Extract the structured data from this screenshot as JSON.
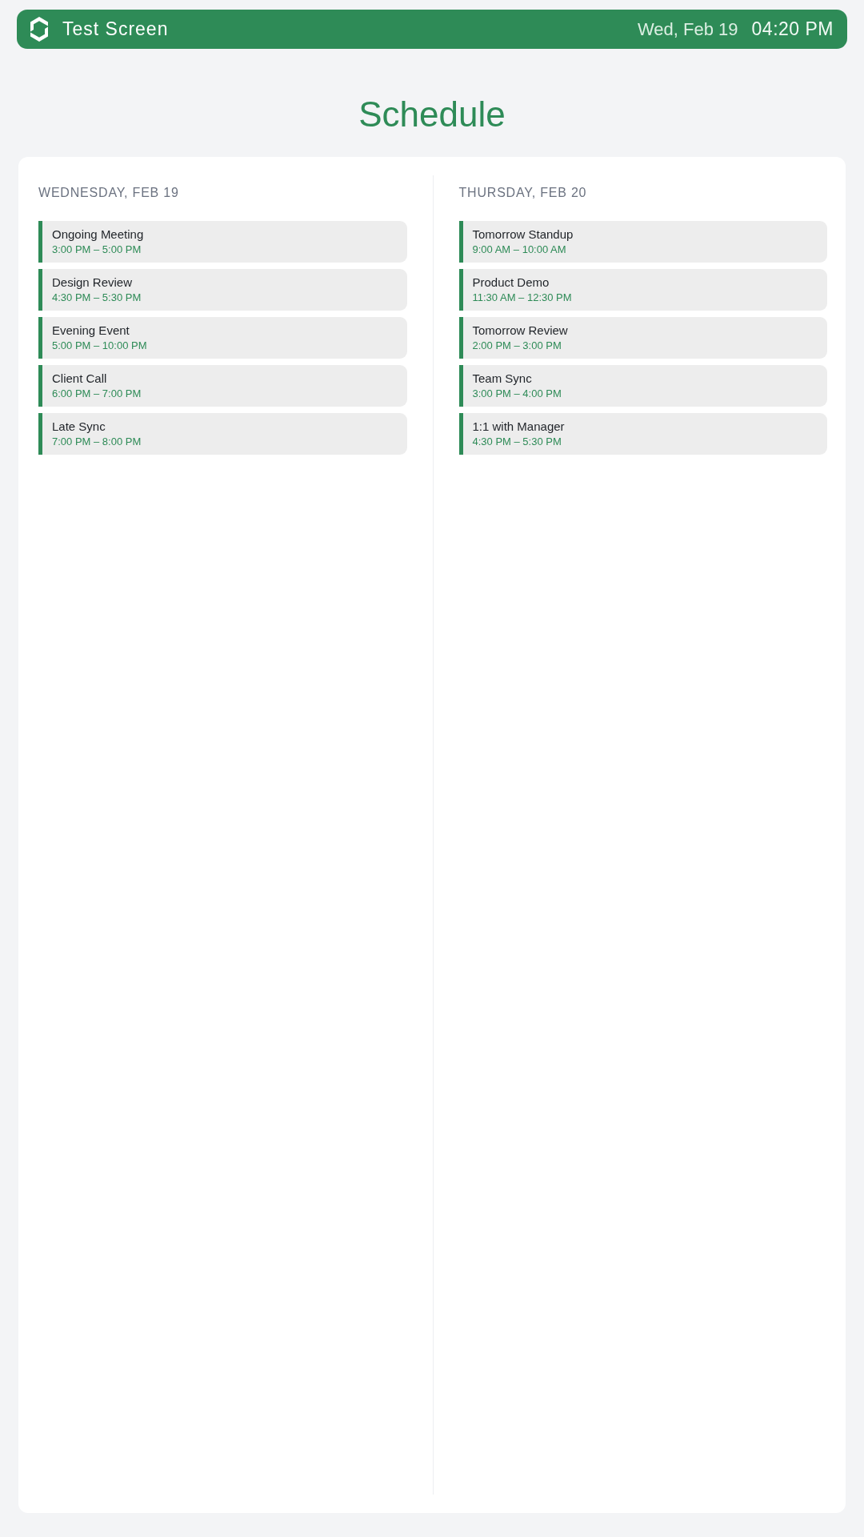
{
  "header": {
    "title": "Test Screen",
    "date": "Wed, Feb 19",
    "time": "04:20 PM"
  },
  "page_title": "Schedule",
  "days": [
    {
      "heading": "WEDNESDAY, FEB 19",
      "events": [
        {
          "title": "Ongoing Meeting",
          "time": "3:00 PM – 5:00 PM"
        },
        {
          "title": "Design Review",
          "time": "4:30 PM – 5:30 PM"
        },
        {
          "title": "Evening Event",
          "time": "5:00 PM – 10:00 PM"
        },
        {
          "title": "Client Call",
          "time": "6:00 PM – 7:00 PM"
        },
        {
          "title": "Late Sync",
          "time": "7:00 PM – 8:00 PM"
        }
      ]
    },
    {
      "heading": "THURSDAY, FEB 20",
      "events": [
        {
          "title": "Tomorrow Standup",
          "time": "9:00 AM – 10:00 AM"
        },
        {
          "title": "Product Demo",
          "time": "11:30 AM – 12:30 PM"
        },
        {
          "title": "Tomorrow Review",
          "time": "2:00 PM – 3:00 PM"
        },
        {
          "title": "Team Sync",
          "time": "3:00 PM – 4:00 PM"
        },
        {
          "title": "1:1 with Manager",
          "time": "4:30 PM – 5:30 PM"
        }
      ]
    }
  ]
}
